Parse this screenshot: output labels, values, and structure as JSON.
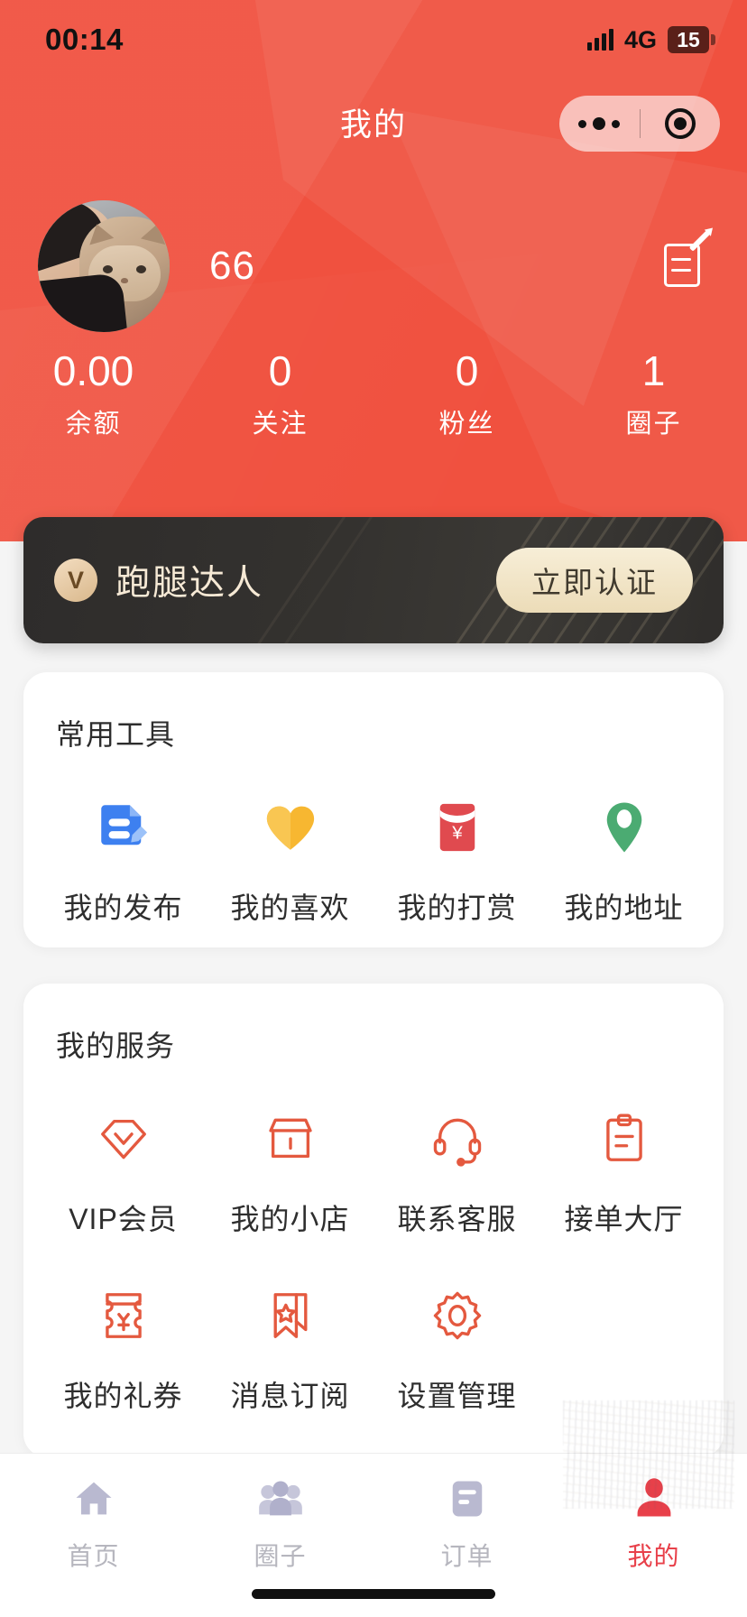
{
  "status_bar": {
    "time": "00:14",
    "network": "4G",
    "battery": "15",
    "signal_icon": "signal-bars-icon",
    "battery_icon": "battery-icon"
  },
  "header": {
    "title": "我的",
    "capsule": {
      "menu_icon": "more-dots-icon",
      "target_icon": "target-circle-icon"
    }
  },
  "profile": {
    "avatar_name": "user-avatar",
    "username": "66",
    "edit_icon": "edit-profile-icon"
  },
  "stats": [
    {
      "value": "0.00",
      "label": "余额"
    },
    {
      "value": "0",
      "label": "关注"
    },
    {
      "value": "0",
      "label": "粉丝"
    },
    {
      "value": "1",
      "label": "圈子"
    }
  ],
  "verify_card": {
    "badge": "V",
    "title": "跑腿达人",
    "button_label": "立即认证"
  },
  "tools_section": {
    "title": "常用工具",
    "items": [
      {
        "label": "我的发布",
        "icon": "document-edit-icon",
        "color": "#3d80f0"
      },
      {
        "label": "我的喜欢",
        "icon": "heart-icon",
        "color": "#f7b731"
      },
      {
        "label": "我的打赏",
        "icon": "red-envelope-icon",
        "color": "#e04a4f"
      },
      {
        "label": "我的地址",
        "icon": "location-pin-icon",
        "color": "#4bab72"
      }
    ]
  },
  "services_section": {
    "title": "我的服务",
    "accent_color": "#e4593f",
    "items": [
      {
        "label": "VIP会员",
        "icon": "diamond-icon"
      },
      {
        "label": "我的小店",
        "icon": "shop-icon"
      },
      {
        "label": "联系客服",
        "icon": "headset-icon"
      },
      {
        "label": "接单大厅",
        "icon": "clipboard-icon"
      },
      {
        "label": "我的礼券",
        "icon": "coupon-yuan-icon"
      },
      {
        "label": "消息订阅",
        "icon": "bookmark-star-icon"
      },
      {
        "label": "设置管理",
        "icon": "gear-icon"
      }
    ]
  },
  "tabbar": {
    "active_color": "#e8404a",
    "inactive_color": "#b6b6be",
    "items": [
      {
        "label": "首页",
        "icon": "home-icon",
        "active": false
      },
      {
        "label": "圈子",
        "icon": "people-group-icon",
        "active": false
      },
      {
        "label": "订单",
        "icon": "order-list-icon",
        "active": false
      },
      {
        "label": "我的",
        "icon": "person-icon",
        "active": true
      }
    ]
  }
}
